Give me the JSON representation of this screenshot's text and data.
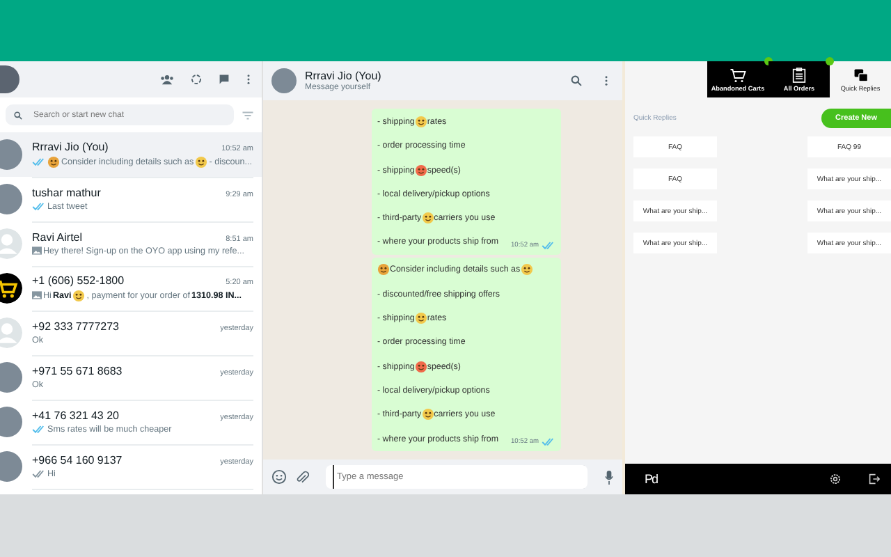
{
  "sidebar": {
    "search": {
      "placeholder": "Search or start new chat"
    },
    "chats": [
      {
        "name": "Rrravi Jio (You)",
        "time": "10:52 am",
        "selected": true,
        "ticks": true,
        "read": true,
        "media": false,
        "kind": "photo",
        "preview": [
          {
            "kind": "emoji",
            "color": "#e8a33a"
          },
          {
            "kind": "text",
            "text": "Consider including details such as"
          },
          {
            "kind": "emoji",
            "color": "#f2c94c"
          },
          {
            "kind": "text",
            "text": " - discoun..."
          }
        ]
      },
      {
        "name": "tushar mathur",
        "time": "9:29 am",
        "selected": false,
        "ticks": true,
        "read": true,
        "media": false,
        "kind": "photo",
        "preview": [
          {
            "kind": "text",
            "text": "Last tweet"
          }
        ]
      },
      {
        "name": "Ravi Airtel",
        "time": "8:51 am",
        "selected": false,
        "ticks": false,
        "media": true,
        "kind": "default",
        "preview": [
          {
            "kind": "text",
            "text": "Hey there! Sign-up on the OYO app using my refe..."
          }
        ]
      },
      {
        "name": "+1 (606) 552-1800",
        "time": "5:20 am",
        "selected": false,
        "ticks": false,
        "media": true,
        "kind": "cart",
        "preview": [
          {
            "kind": "text",
            "text": "Hi "
          },
          {
            "kind": "bold",
            "text": "Ravi"
          },
          {
            "kind": "emoji",
            "color": "#f2c94c"
          },
          {
            "kind": "text",
            "text": ", payment for your order of "
          },
          {
            "kind": "bold",
            "text": "1310.98 IN..."
          }
        ]
      },
      {
        "name": "+92 333 7777273",
        "time": "yesterday",
        "selected": false,
        "ticks": false,
        "media": false,
        "kind": "default",
        "preview": [
          {
            "kind": "text",
            "text": "Ok"
          }
        ]
      },
      {
        "name": "+971 55 671 8683",
        "time": "yesterday",
        "selected": false,
        "ticks": false,
        "media": false,
        "kind": "photo",
        "preview": [
          {
            "kind": "text",
            "text": "Ok"
          }
        ]
      },
      {
        "name": "+41 76 321 43 20",
        "time": "yesterday",
        "selected": false,
        "ticks": true,
        "read": true,
        "media": false,
        "kind": "photo",
        "preview": [
          {
            "kind": "text",
            "text": "Sms rates will be much cheaper"
          }
        ]
      },
      {
        "name": "+966 54 160 9137",
        "time": "yesterday",
        "selected": false,
        "ticks": true,
        "read": false,
        "media": false,
        "kind": "photo",
        "preview": [
          {
            "kind": "text",
            "text": "Hi"
          }
        ]
      }
    ]
  },
  "chat": {
    "title": "Rrravi Jio (You)",
    "subtitle": "Message yourself",
    "messages": [
      {
        "time": "10:52 am",
        "read": true,
        "lines": [
          [
            {
              "kind": "text",
              "text": "- shipping"
            },
            {
              "kind": "emoji",
              "color": "#f2c94c"
            },
            {
              "kind": "text",
              "text": "rates"
            }
          ],
          [
            {
              "kind": "text",
              "text": "- order processing time"
            }
          ],
          [
            {
              "kind": "text",
              "text": "- shipping"
            },
            {
              "kind": "emoji",
              "color": "#f06a4a"
            },
            {
              "kind": "text",
              "text": "speed(s)"
            }
          ],
          [
            {
              "kind": "text",
              "text": "- local delivery/pickup options"
            }
          ],
          [
            {
              "kind": "text",
              "text": "- third-party"
            },
            {
              "kind": "emoji",
              "color": "#f2c94c"
            },
            {
              "kind": "text",
              "text": " carriers you use"
            }
          ],
          [
            {
              "kind": "text",
              "text": "- where your products ship from"
            }
          ]
        ]
      },
      {
        "time": "10:52 am",
        "read": true,
        "lines": [
          [
            {
              "kind": "emoji",
              "color": "#e8a33a"
            },
            {
              "kind": "text",
              "text": "Consider including details such as"
            },
            {
              "kind": "emoji",
              "color": "#f2c94c"
            }
          ],
          [
            {
              "kind": "text",
              "text": "- discounted/free shipping offers"
            }
          ],
          [
            {
              "kind": "text",
              "text": "- shipping"
            },
            {
              "kind": "emoji",
              "color": "#f2c94c"
            },
            {
              "kind": "text",
              "text": "rates"
            }
          ],
          [
            {
              "kind": "text",
              "text": "- order processing time"
            }
          ],
          [
            {
              "kind": "text",
              "text": "- shipping"
            },
            {
              "kind": "emoji",
              "color": "#f06a4a"
            },
            {
              "kind": "text",
              "text": "speed(s)"
            }
          ],
          [
            {
              "kind": "text",
              "text": "- local delivery/pickup options"
            }
          ],
          [
            {
              "kind": "text",
              "text": "- third-party"
            },
            {
              "kind": "emoji",
              "color": "#f2c94c"
            },
            {
              "kind": "text",
              "text": " carriers you use"
            }
          ],
          [
            {
              "kind": "text",
              "text": "- where your products ship from"
            }
          ]
        ]
      }
    ],
    "input": {
      "placeholder": "Type a message"
    }
  },
  "extension": {
    "tabs": [
      {
        "label": "Abandoned Carts",
        "kind": "cart",
        "selected": false,
        "badge": true
      },
      {
        "label": "All Orders",
        "kind": "orders",
        "selected": false,
        "badge": true
      },
      {
        "label": "Quick Replies",
        "kind": "replies",
        "selected": true,
        "badge": false
      }
    ],
    "section_title": "Quick Replies",
    "create_button": "Create New",
    "replies": [
      "FAQ",
      "FAQ 99",
      "FAQ",
      "What are your ship...",
      "What are your ship...",
      "What are your ship...",
      "What are your ship...",
      "What are your ship..."
    ],
    "logo": "Pd"
  }
}
